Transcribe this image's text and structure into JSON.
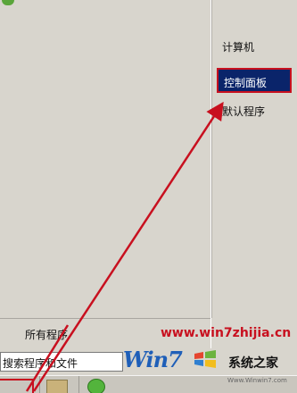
{
  "start_menu": {
    "right_pane": {
      "computer": "计算机",
      "control_panel": "控制面板",
      "default_programs": "默认程序"
    },
    "all_programs": "所有程序",
    "search": {
      "value": "搜索程序和文件"
    }
  },
  "watermark": {
    "url": "www.win7zhijia.cn",
    "brand_latin": "Win7",
    "brand_cn": "系统之家",
    "small_text": "Www.Winwin7.com"
  },
  "colors": {
    "highlight_bg": "#0a246a",
    "annotation_red": "#c8101f",
    "watermark_blue": "#1f5fb8"
  }
}
